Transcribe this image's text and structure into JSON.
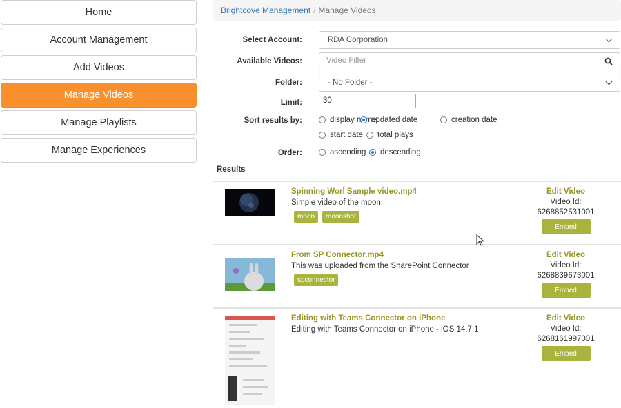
{
  "nav": {
    "items": [
      {
        "label": "Home"
      },
      {
        "label": "Account Management"
      },
      {
        "label": "Add Videos"
      },
      {
        "label": "Manage Videos"
      },
      {
        "label": "Manage Playlists"
      },
      {
        "label": "Manage Experiences"
      }
    ],
    "active_index": 3,
    "active_color": "#f7902d"
  },
  "breadcrumb": {
    "link": "Brightcove Management",
    "separator": "/",
    "current": "Manage Videos"
  },
  "form": {
    "account_label": "Select Account:",
    "account_value": "RDA Corporation",
    "videos_label": "Available Videos:",
    "videos_placeholder": "Video Filter",
    "folder_label": "Folder:",
    "folder_value": "- No Folder -",
    "limit_label": "Limit:",
    "limit_value": "30",
    "sort_label": "Sort results by:",
    "sort_options": [
      {
        "label": "display name",
        "checked": false
      },
      {
        "label": "updated date",
        "checked": true
      },
      {
        "label": "creation date",
        "checked": false
      },
      {
        "label": "start date",
        "checked": false
      },
      {
        "label": "total plays",
        "checked": false
      }
    ],
    "order_label": "Order:",
    "order_options": [
      {
        "label": "ascending",
        "checked": false
      },
      {
        "label": "descending",
        "checked": true
      }
    ]
  },
  "results": {
    "heading": "Results",
    "edit_label": "Edit Video",
    "id_label": "Video Id:",
    "embed_label": "Embed",
    "items": [
      {
        "title": "Spinning Worl Sample video.mp4",
        "description": "Simple video of the moon",
        "tags": [
          "moon",
          "moonshot"
        ],
        "video_id": "6268852531001",
        "thumbnail": "moon-thumbnail"
      },
      {
        "title": "From SP Connector.mp4",
        "description": "This was uploaded from the SharePoint Connector",
        "tags": [
          "spconnector"
        ],
        "video_id": "6268839673001",
        "thumbnail": "bunny-thumbnail"
      },
      {
        "title": "Editing with Teams Connector on iPhone",
        "description": "Editing with Teams Connector on iPhone - iOS 14.7.1",
        "tags": [],
        "video_id": "6268161997001",
        "thumbnail": "phone-screenshot-thumbnail"
      }
    ]
  },
  "colors": {
    "accent": "#f7902d",
    "olive": "#9a9626",
    "tag_bg": "#a8b43e",
    "link": "#3a78b6"
  }
}
